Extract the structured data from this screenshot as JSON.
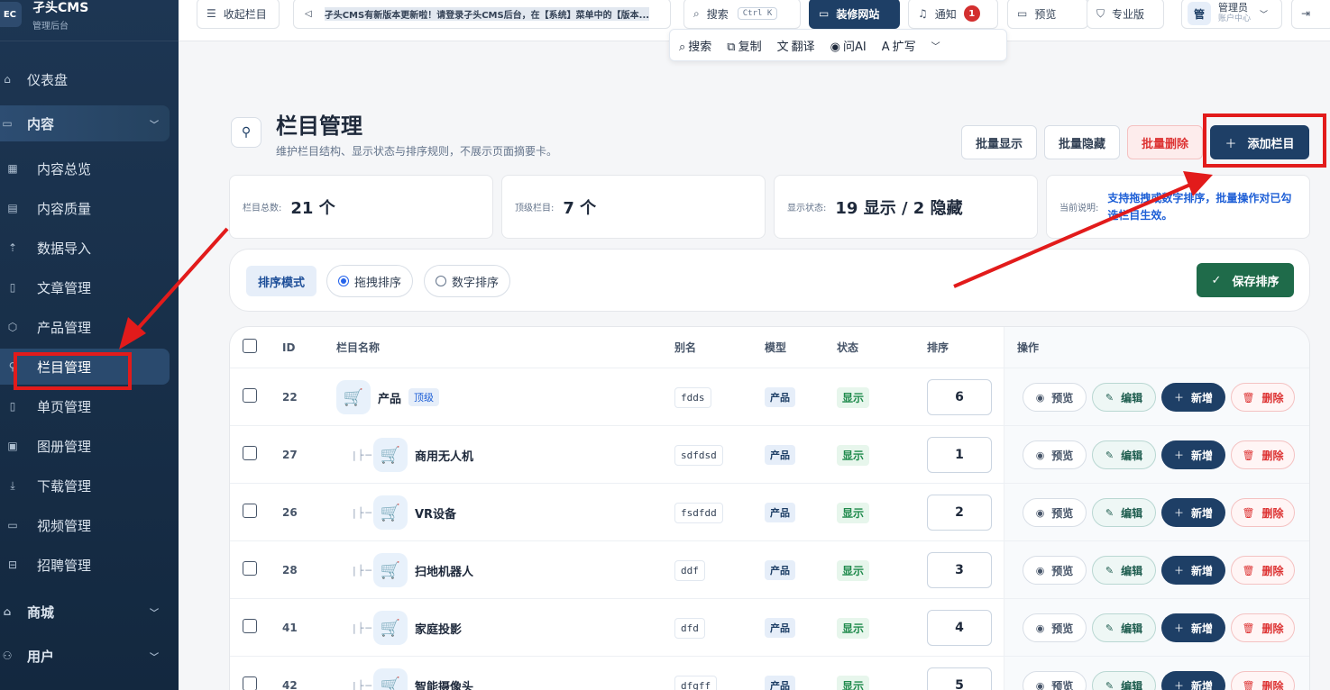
{
  "brand": {
    "logo": "EC",
    "name": "孑头CMS",
    "subtitle": "管理后台"
  },
  "sidebar": {
    "dashboard": "仪表盘",
    "content": "内容",
    "items": [
      "内容总览",
      "内容质量",
      "数据导入",
      "文章管理",
      "产品管理",
      "栏目管理",
      "单页管理",
      "图册管理",
      "下载管理",
      "视频管理",
      "招聘管理"
    ],
    "shop": "商城",
    "users": "用户"
  },
  "topbar": {
    "collapse": "收起栏目",
    "notice": "孑头CMS有新版本更新啦！请登录孑头CMS后台，在【系统】菜单中的【版本...",
    "search": "搜索",
    "search_kbd": "Ctrl K",
    "decorate": "装修网站",
    "notify": "通知",
    "notify_count": "1",
    "preview": "预览",
    "pro": "专业版",
    "admin_avatar": "管",
    "admin_name": "管理员",
    "admin_sub": "账户中心"
  },
  "popup_toolbar": {
    "search": "搜索",
    "copy": "复制",
    "translate": "翻译",
    "ask_ai": "问AI",
    "expand": "扩写"
  },
  "page": {
    "title": "栏目管理",
    "subtitle": "维护栏目结构、显示状态与排序规则，不展示页面摘要卡。",
    "batch_show": "批量显示",
    "batch_hide": "批量隐藏",
    "batch_delete": "批量删除",
    "add_column": "添加栏目"
  },
  "stats": {
    "total_label": "栏目总数:",
    "total_value": "21 个",
    "top_label": "顶级栏目:",
    "top_value": "7 个",
    "status_label": "显示状态:",
    "status_value": "19 显示 / 2 隐藏",
    "note_label": "当前说明:",
    "note_value": "支持拖拽或数字排序，批量操作对已勾选栏目生效。"
  },
  "sort": {
    "mode_label": "排序模式",
    "drag": "拖拽排序",
    "number": "数字排序",
    "save": "保存排序"
  },
  "table": {
    "headers": {
      "id": "ID",
      "name": "栏目名称",
      "alias": "别名",
      "model": "模型",
      "status": "状态",
      "order": "排序",
      "ops": "操作"
    },
    "top_tag": "顶级",
    "ops": {
      "view": "预览",
      "edit": "编辑",
      "add": "新增",
      "del": "删除"
    },
    "rows": [
      {
        "id": "22",
        "name": "产品",
        "alias": "fdds",
        "model": "产品",
        "status": "显示",
        "order": "6"
      },
      {
        "id": "27",
        "name": "商用无人机",
        "alias": "sdfdsd",
        "model": "产品",
        "status": "显示",
        "order": "1"
      },
      {
        "id": "26",
        "name": "VR设备",
        "alias": "fsdfdd",
        "model": "产品",
        "status": "显示",
        "order": "2"
      },
      {
        "id": "28",
        "name": "扫地机器人",
        "alias": "ddf",
        "model": "产品",
        "status": "显示",
        "order": "3"
      },
      {
        "id": "41",
        "name": "家庭投影",
        "alias": "dfd",
        "model": "产品",
        "status": "显示",
        "order": "4"
      },
      {
        "id": "42",
        "name": "智能摄像头",
        "alias": "dfgff",
        "model": "产品",
        "status": "显示",
        "order": "5"
      }
    ]
  }
}
